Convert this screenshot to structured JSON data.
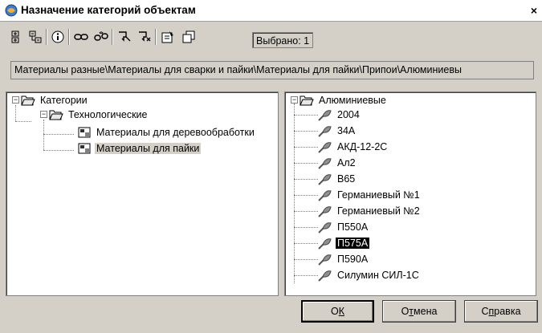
{
  "window": {
    "title": "Назначение категорий объектам",
    "close_glyph": "×"
  },
  "toolbar": {
    "buttons": [
      "expand-tree-icon",
      "collapse-tree-icon",
      "info-icon",
      "link-icon",
      "unlink-icon",
      "assign-category-icon",
      "remove-category-icon",
      "properties-icon",
      "copy-icon"
    ],
    "selected_label": "Выбрано: 1"
  },
  "path": "Материалы разные\\Материалы для сварки и пайки\\Материалы для пайки\\Припои\\Алюминиевы",
  "left_tree": [
    {
      "label": "Категории"
    },
    {
      "label": "Технологические"
    },
    {
      "label": "Материалы для деревообработки"
    },
    {
      "label": "Материалы для пайки"
    }
  ],
  "right_tree": {
    "root": "Алюминиевые",
    "items": [
      "2004",
      "34А",
      "АКД-12-2С",
      "Ал2",
      "В65",
      "Германиевый №1",
      "Германиевый №2",
      "П550А",
      "П575А",
      "П590А",
      "Силумин СИЛ-1С"
    ],
    "selected_index": 8
  },
  "buttons": {
    "ok": {
      "pre": "О",
      "accel": "К",
      "post": ""
    },
    "cancel": {
      "pre": "О",
      "accel": "т",
      "post": "мена"
    },
    "help": {
      "pre": "С",
      "accel": "п",
      "post": "равка"
    }
  }
}
